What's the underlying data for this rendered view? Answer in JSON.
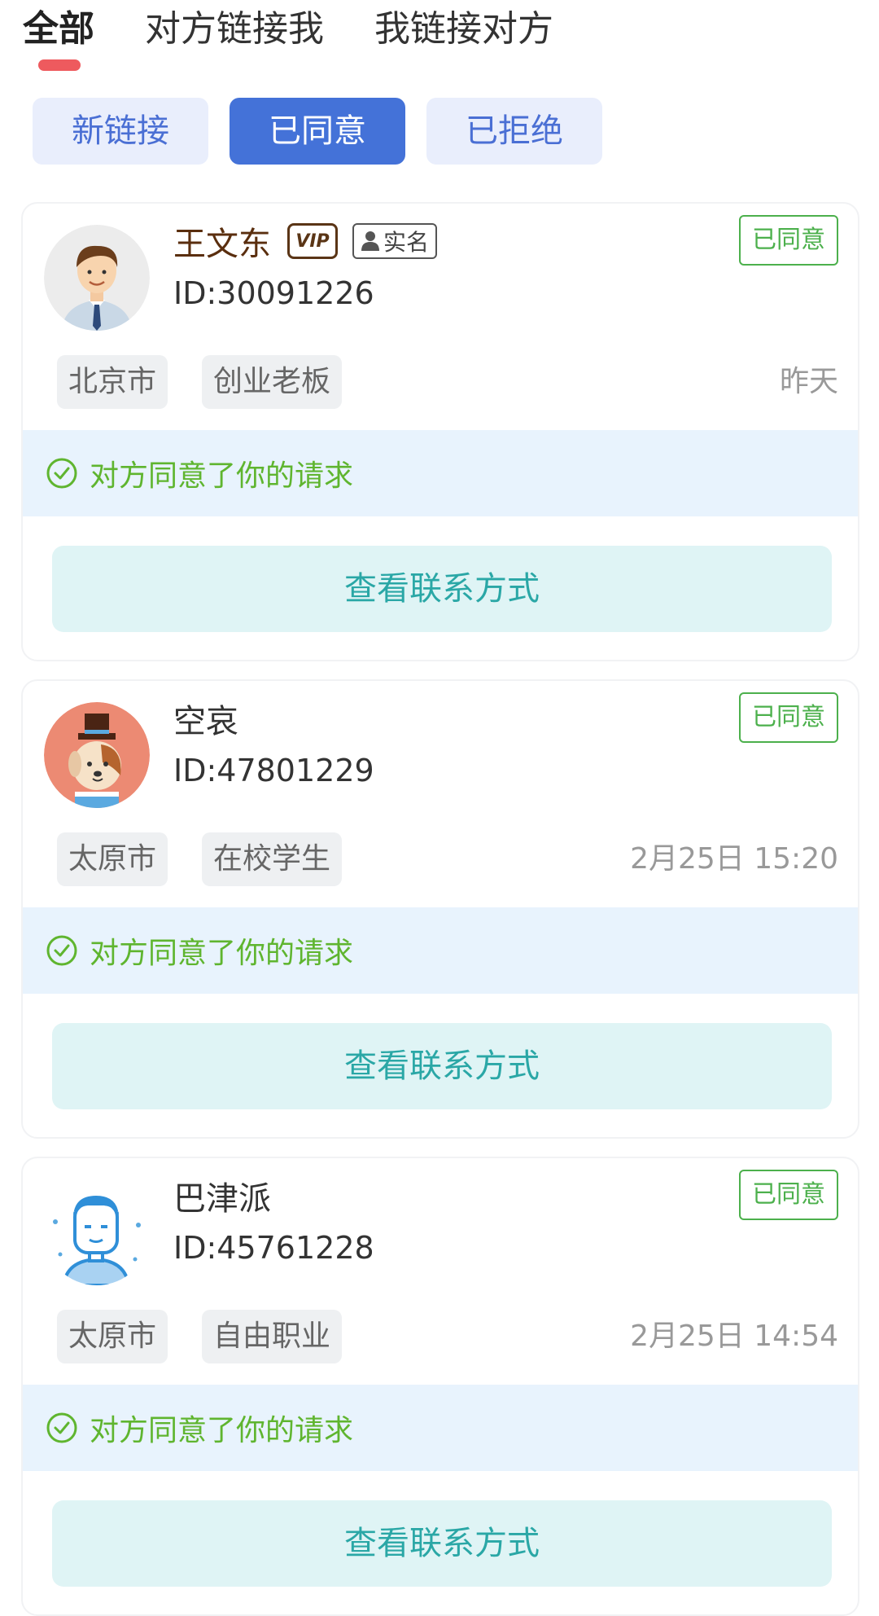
{
  "tabs": {
    "all": "全部",
    "linked_me": "对方链接我",
    "i_linked": "我链接对方"
  },
  "filters": {
    "new": "新链接",
    "agreed": "已同意",
    "rejected": "已拒绝"
  },
  "colors": {
    "indicator": "#ee5a5e",
    "chip_active": "#4472d8",
    "status_green": "#4cb04c",
    "notice_bg": "#e8f3fd",
    "button_bg": "#dff4f5",
    "button_text": "#2aa7a6"
  },
  "cards": [
    {
      "name": "王文东",
      "vip": "VIP",
      "realname": "实名",
      "uid": "ID:30091226",
      "status": "已同意",
      "tags": [
        "北京市",
        "创业老板"
      ],
      "time": "昨天",
      "notice": "对方同意了你的请求",
      "button": "查看联系方式",
      "avatar_icon": "businessman-avatar"
    },
    {
      "name": "空哀",
      "uid": "ID:47801229",
      "status": "已同意",
      "tags": [
        "太原市",
        "在校学生"
      ],
      "time": "2月25日 15:20",
      "notice": "对方同意了你的请求",
      "button": "查看联系方式",
      "avatar_icon": "dog-with-hat-avatar"
    },
    {
      "name": "巴津派",
      "uid": "ID:45761228",
      "status": "已同意",
      "tags": [
        "太原市",
        "自由职业"
      ],
      "time": "2月25日 14:54",
      "notice": "对方同意了你的请求",
      "button": "查看联系方式",
      "avatar_icon": "blue-man-avatar"
    }
  ]
}
